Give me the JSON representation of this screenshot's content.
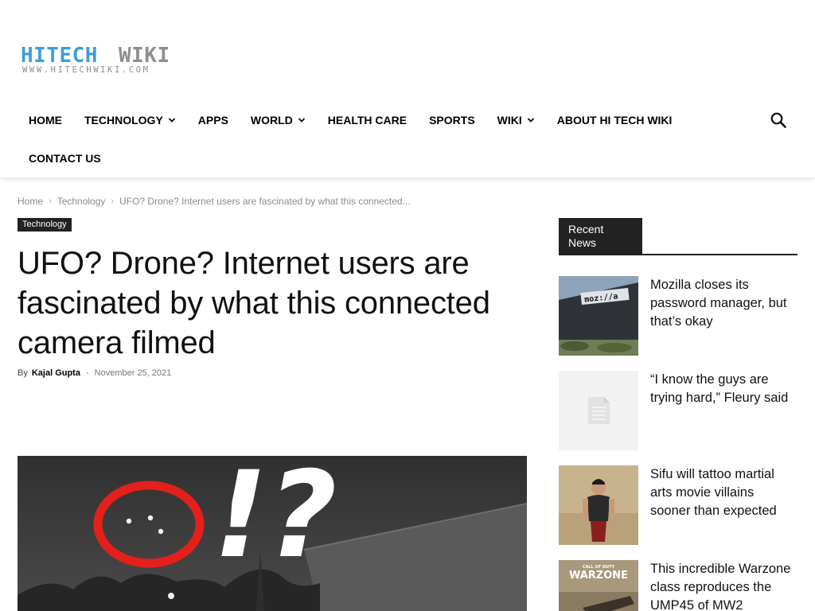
{
  "site": {
    "logo_text_a": "HITECH",
    "logo_text_b": "WIKI",
    "logo_url_text": "WWW.HITECHWIKI.COM"
  },
  "nav": {
    "items": [
      {
        "label": "HOME",
        "has_dropdown": false
      },
      {
        "label": "TECHNOLOGY",
        "has_dropdown": true
      },
      {
        "label": "APPS",
        "has_dropdown": false
      },
      {
        "label": "WORLD",
        "has_dropdown": true
      },
      {
        "label": "HEALTH CARE",
        "has_dropdown": false
      },
      {
        "label": "SPORTS",
        "has_dropdown": false
      },
      {
        "label": "WIKI",
        "has_dropdown": true
      },
      {
        "label": "ABOUT HI TECH WIKI",
        "has_dropdown": false
      },
      {
        "label": "CONTACT US",
        "has_dropdown": false
      }
    ],
    "search_icon": "search-icon"
  },
  "breadcrumb": {
    "home": "Home",
    "category": "Technology",
    "current": "UFO? Drone? Internet users are fascinated by what this connected..."
  },
  "article": {
    "category": "Technology",
    "title": "UFO? Drone? Internet users are fascinated by what this connected camera filmed",
    "by": "By",
    "author": "Kajal Gupta",
    "dash": "-",
    "date": "November 25, 2021",
    "hero_overlay": "!?"
  },
  "sidebar": {
    "widget_title": "Recent News",
    "items": [
      {
        "title": "Mozilla closes its password manager, but that’s okay",
        "thumb_text": "moz://a"
      },
      {
        "title": "“I know the guys are trying hard,” Fleury said",
        "thumb_icon": "document-icon"
      },
      {
        "title": "Sifu will tattoo martial arts movie villains sooner than expected"
      },
      {
        "title": "This incredible Warzone class reproduces the UMP45 of MW2",
        "thumb_text_a": "CALL OF DUTY",
        "thumb_text_b": "WARZONE"
      }
    ]
  },
  "colors": {
    "logo_blue": "#3b9fd8",
    "logo_gray": "#8e8e8e",
    "dark": "#222222",
    "hero_ring": "#e3201b"
  }
}
